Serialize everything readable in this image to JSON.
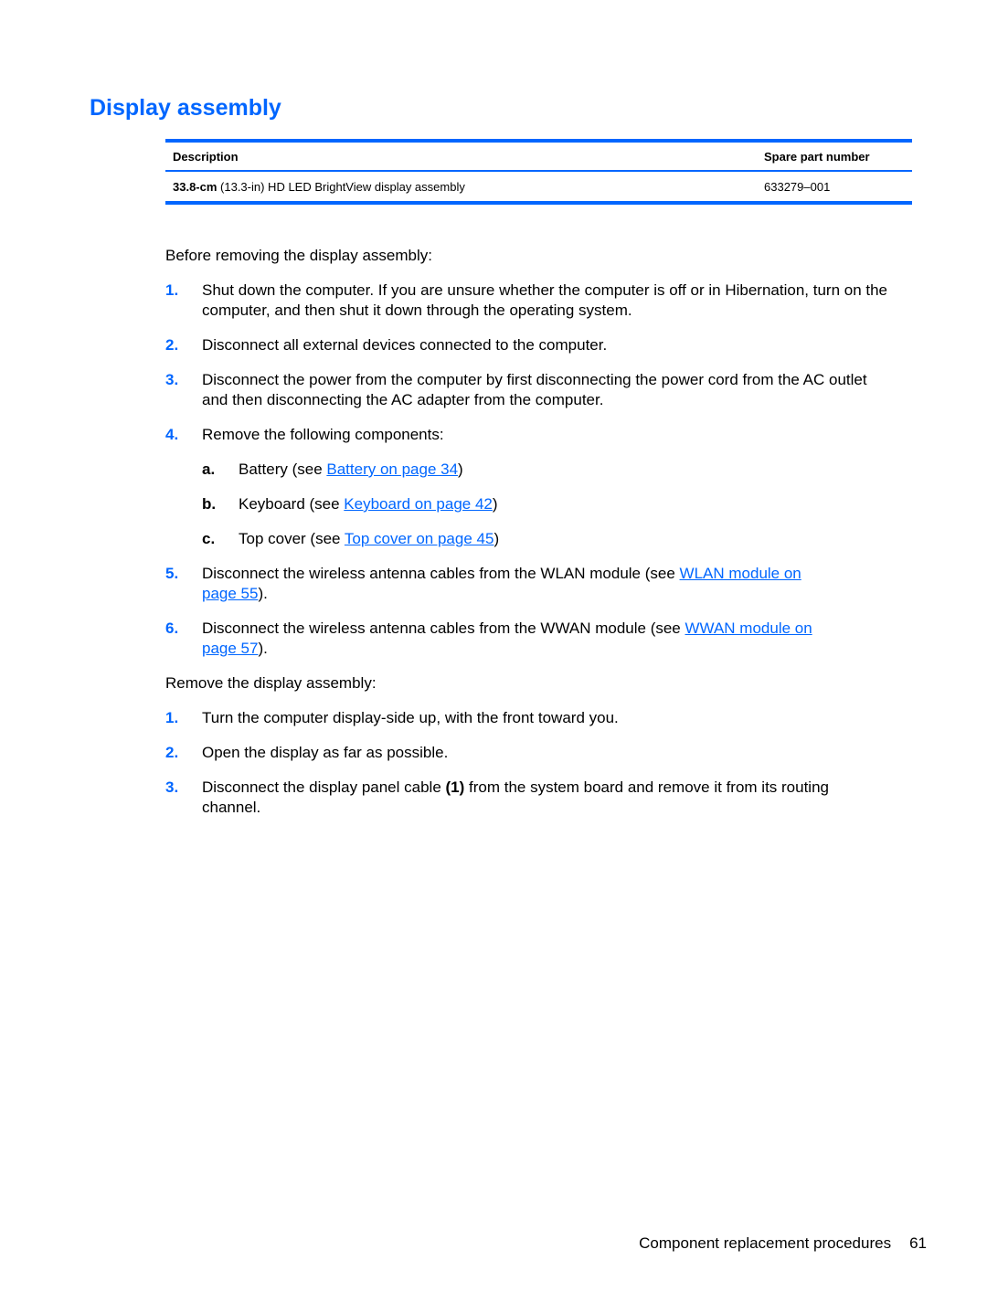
{
  "section_title": "Display assembly",
  "table": {
    "headers": {
      "description": "Description",
      "part_number": "Spare part number"
    },
    "rows": [
      {
        "desc_bold": "33.8-cm",
        "desc_rest": " (13.3-in) HD LED BrightView display assembly",
        "part_number": "633279–001"
      }
    ]
  },
  "before_intro": "Before removing the display assembly:",
  "before_steps": [
    {
      "num": "1.",
      "text": "Shut down the computer. If you are unsure whether the computer is off or in Hibernation, turn on the computer, and then shut it down through the operating system."
    },
    {
      "num": "2.",
      "text": "Disconnect all external devices connected to the computer."
    },
    {
      "num": "3.",
      "text": "Disconnect the power from the computer by first disconnecting the power cord from the AC outlet and then disconnecting the AC adapter from the computer."
    },
    {
      "num": "4.",
      "text": "Remove the following components:"
    },
    {
      "num": "5.",
      "text": "Disconnect the wireless antenna cables from the WLAN module (see ",
      "link": "WLAN module on page 55",
      "after": ")."
    },
    {
      "num": "6.",
      "text": "Disconnect the wireless antenna cables from the WWAN module (see ",
      "link": "WWAN module on page 57",
      "after": ")."
    }
  ],
  "components": [
    {
      "letter": "a.",
      "text": "Battery (see ",
      "link": "Battery on page 34",
      "after": ")"
    },
    {
      "letter": "b.",
      "text": "Keyboard (see ",
      "link": "Keyboard on page 42",
      "after": ")"
    },
    {
      "letter": "c.",
      "text": "Top cover (see ",
      "link": "Top cover on page 45",
      "after": ")"
    }
  ],
  "remove_intro": "Remove the display assembly:",
  "remove_steps": [
    {
      "num": "1.",
      "text": "Turn the computer display-side up, with the front toward you."
    },
    {
      "num": "2.",
      "text": "Open the display as far as possible."
    },
    {
      "num": "3.",
      "text_before": "Disconnect the display panel cable ",
      "bold": "(1)",
      "text_after": " from the system board and remove it from its routing channel."
    }
  ],
  "footer": {
    "section": "Component replacement procedures",
    "page": "61"
  },
  "colors": {
    "accent": "#0066ff",
    "text": "#000000"
  }
}
